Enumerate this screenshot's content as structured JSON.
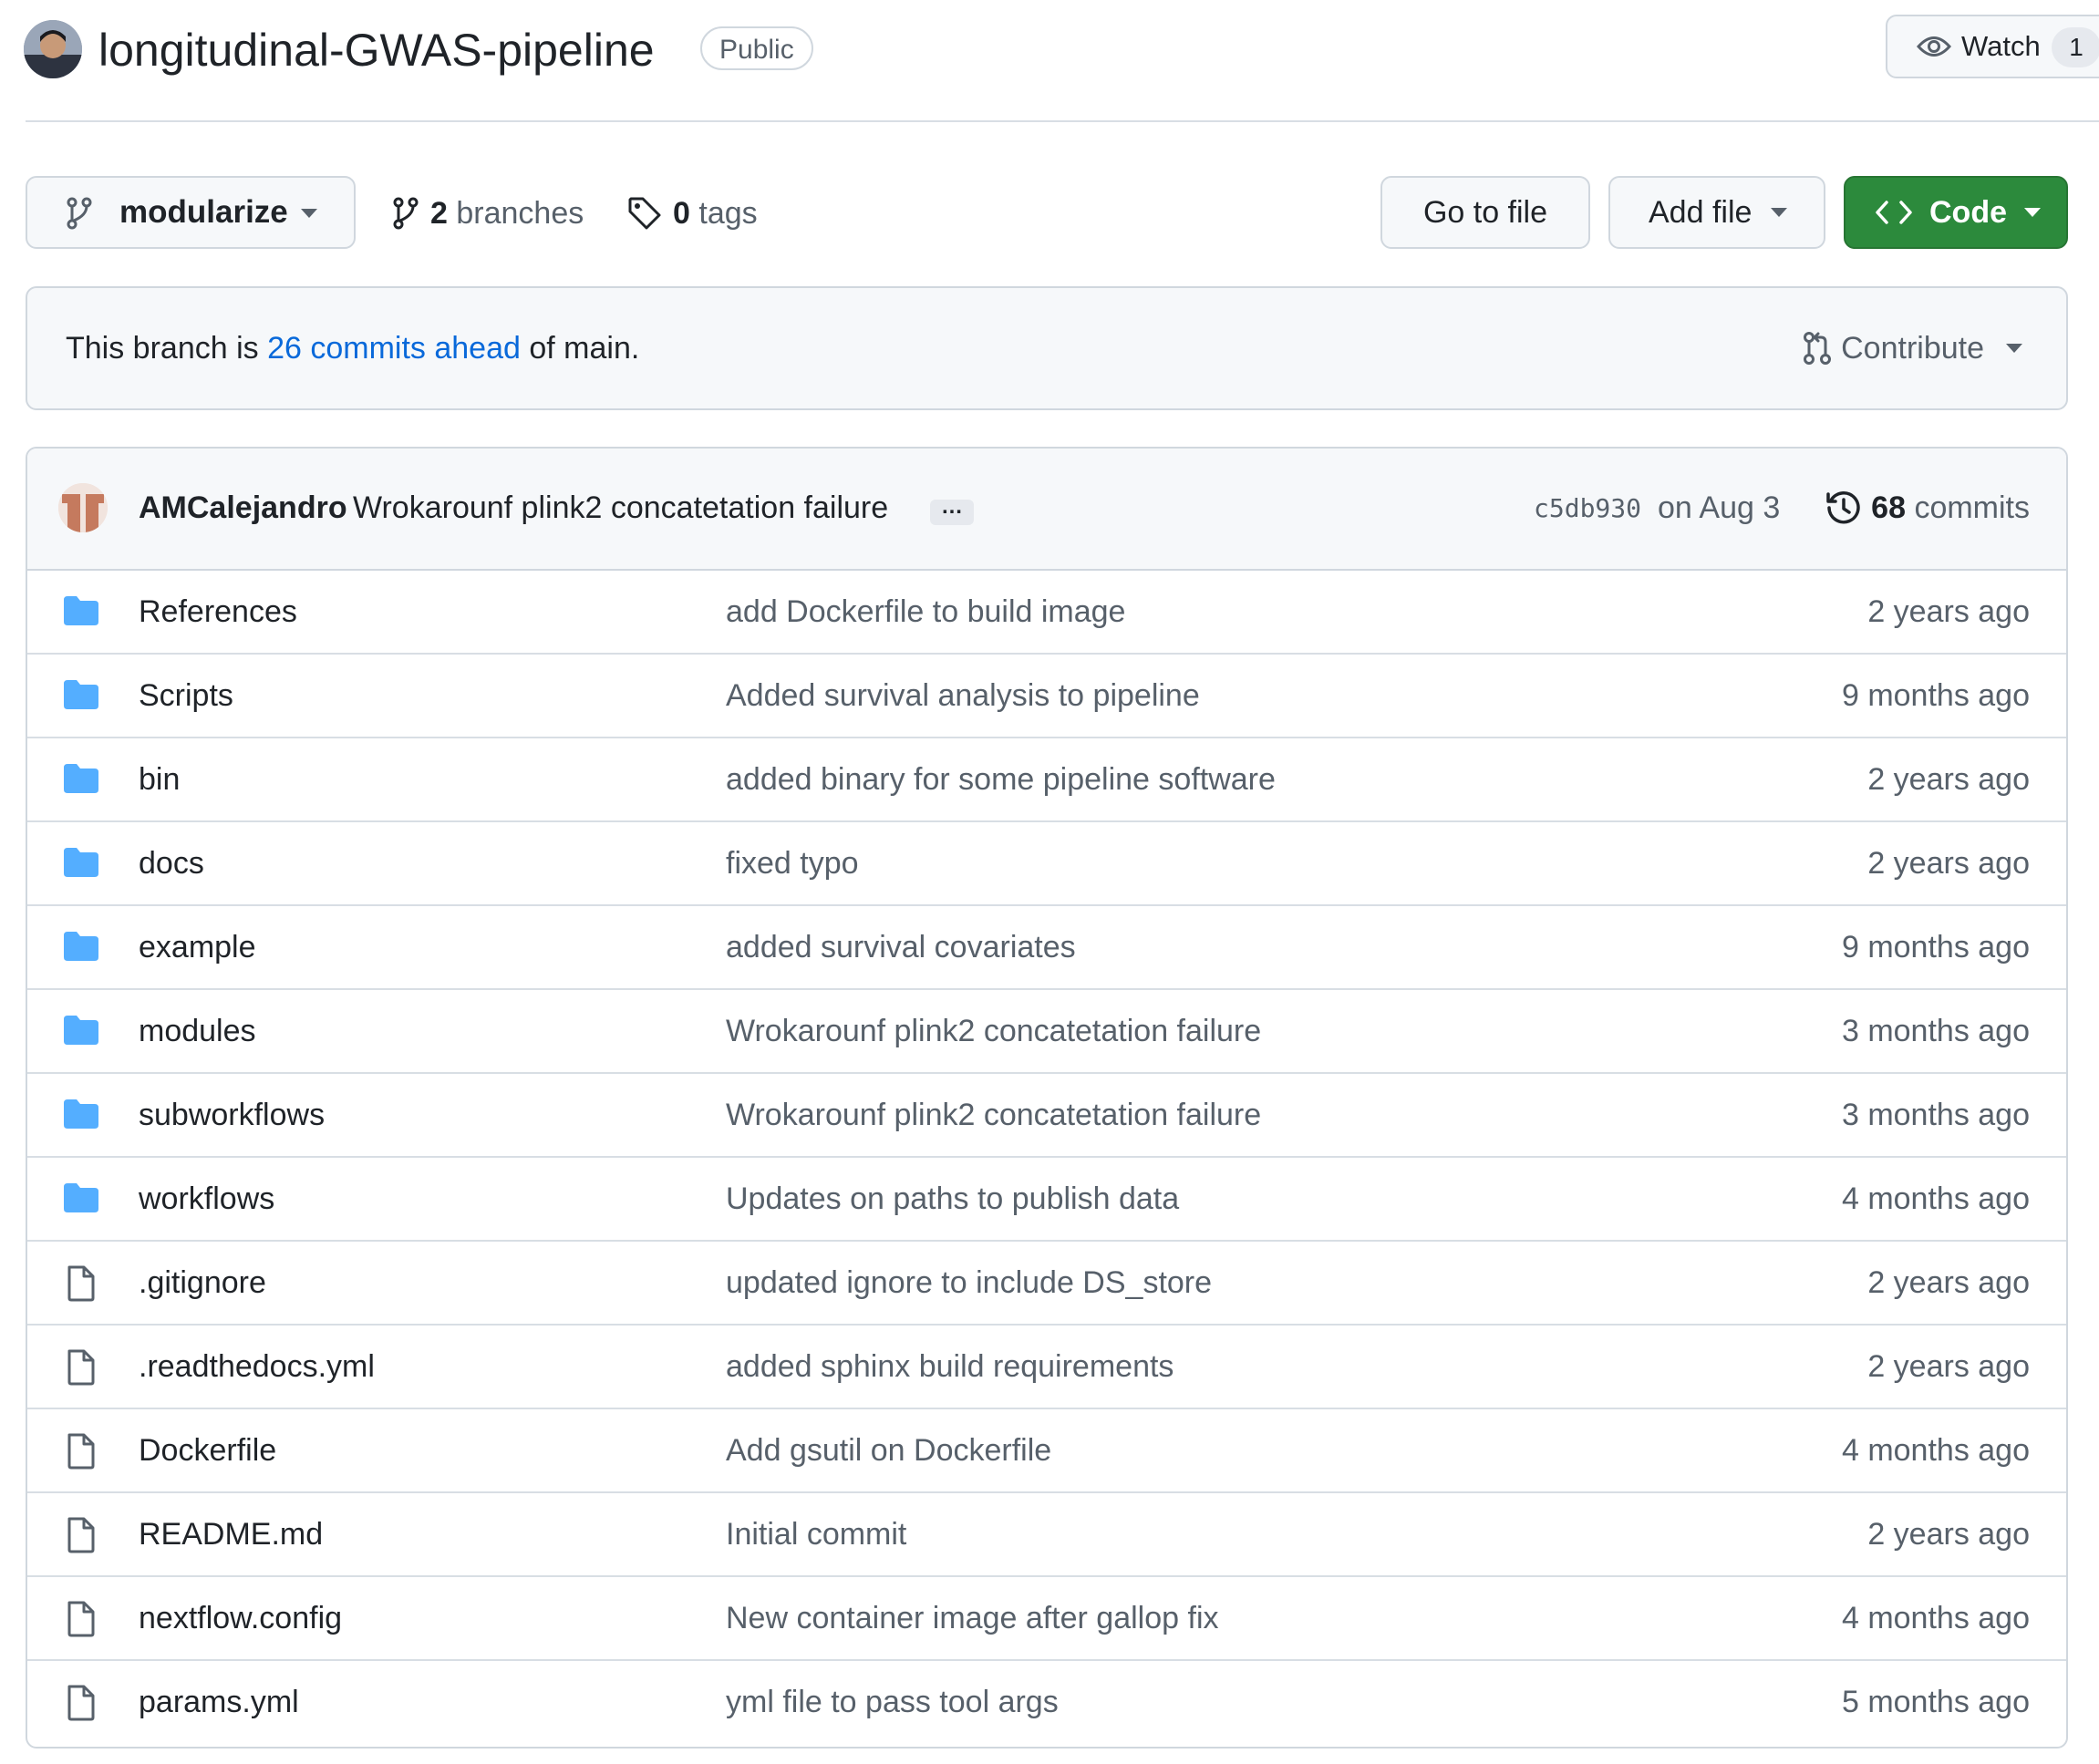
{
  "repo": {
    "name": "longitudinal-GWAS-pipeline",
    "visibility": "Public",
    "watch_label": "Watch",
    "watch_count": "1"
  },
  "toolbar": {
    "branch_name": "modularize",
    "branches_count": "2",
    "branches_label": "branches",
    "tags_count": "0",
    "tags_label": "tags",
    "goto_file_label": "Go to file",
    "add_file_label": "Add file",
    "code_label": "Code"
  },
  "branch_status": {
    "prefix": "This branch is ",
    "link": "26 commits ahead",
    "suffix": " of main.",
    "contribute_label": "Contribute"
  },
  "latest_commit": {
    "author": "AMCalejandro",
    "message": "Wrokarounf plink2 concatetation failure",
    "ellipsis": "…",
    "sha": "c5db930",
    "date": "on Aug 3",
    "commit_count": "68",
    "commits_label": "commits"
  },
  "files": [
    {
      "type": "folder",
      "name": "References",
      "message": "add Dockerfile to build image",
      "age": "2 years ago"
    },
    {
      "type": "folder",
      "name": "Scripts",
      "message": "Added survival analysis to pipeline",
      "age": "9 months ago"
    },
    {
      "type": "folder",
      "name": "bin",
      "message": "added binary for some pipeline software",
      "age": "2 years ago"
    },
    {
      "type": "folder",
      "name": "docs",
      "message": "fixed typo",
      "age": "2 years ago"
    },
    {
      "type": "folder",
      "name": "example",
      "message": "added survival covariates",
      "age": "9 months ago"
    },
    {
      "type": "folder",
      "name": "modules",
      "message": "Wrokarounf plink2 concatetation failure",
      "age": "3 months ago"
    },
    {
      "type": "folder",
      "name": "subworkflows",
      "message": "Wrokarounf plink2 concatetation failure",
      "age": "3 months ago"
    },
    {
      "type": "folder",
      "name": "workflows",
      "message": "Updates on paths to publish data",
      "age": "4 months ago"
    },
    {
      "type": "file",
      "name": ".gitignore",
      "message": "updated ignore to include DS_store",
      "age": "2 years ago"
    },
    {
      "type": "file",
      "name": ".readthedocs.yml",
      "message": "added sphinx build requirements",
      "age": "2 years ago"
    },
    {
      "type": "file",
      "name": "Dockerfile",
      "message": "Add gsutil on Dockerfile",
      "age": "4 months ago"
    },
    {
      "type": "file",
      "name": "README.md",
      "message": "Initial commit",
      "age": "2 years ago"
    },
    {
      "type": "file",
      "name": "nextflow.config",
      "message": "New container image after gallop fix",
      "age": "4 months ago"
    },
    {
      "type": "file",
      "name": "params.yml",
      "message": "yml file to pass tool args",
      "age": "5 months ago"
    }
  ]
}
